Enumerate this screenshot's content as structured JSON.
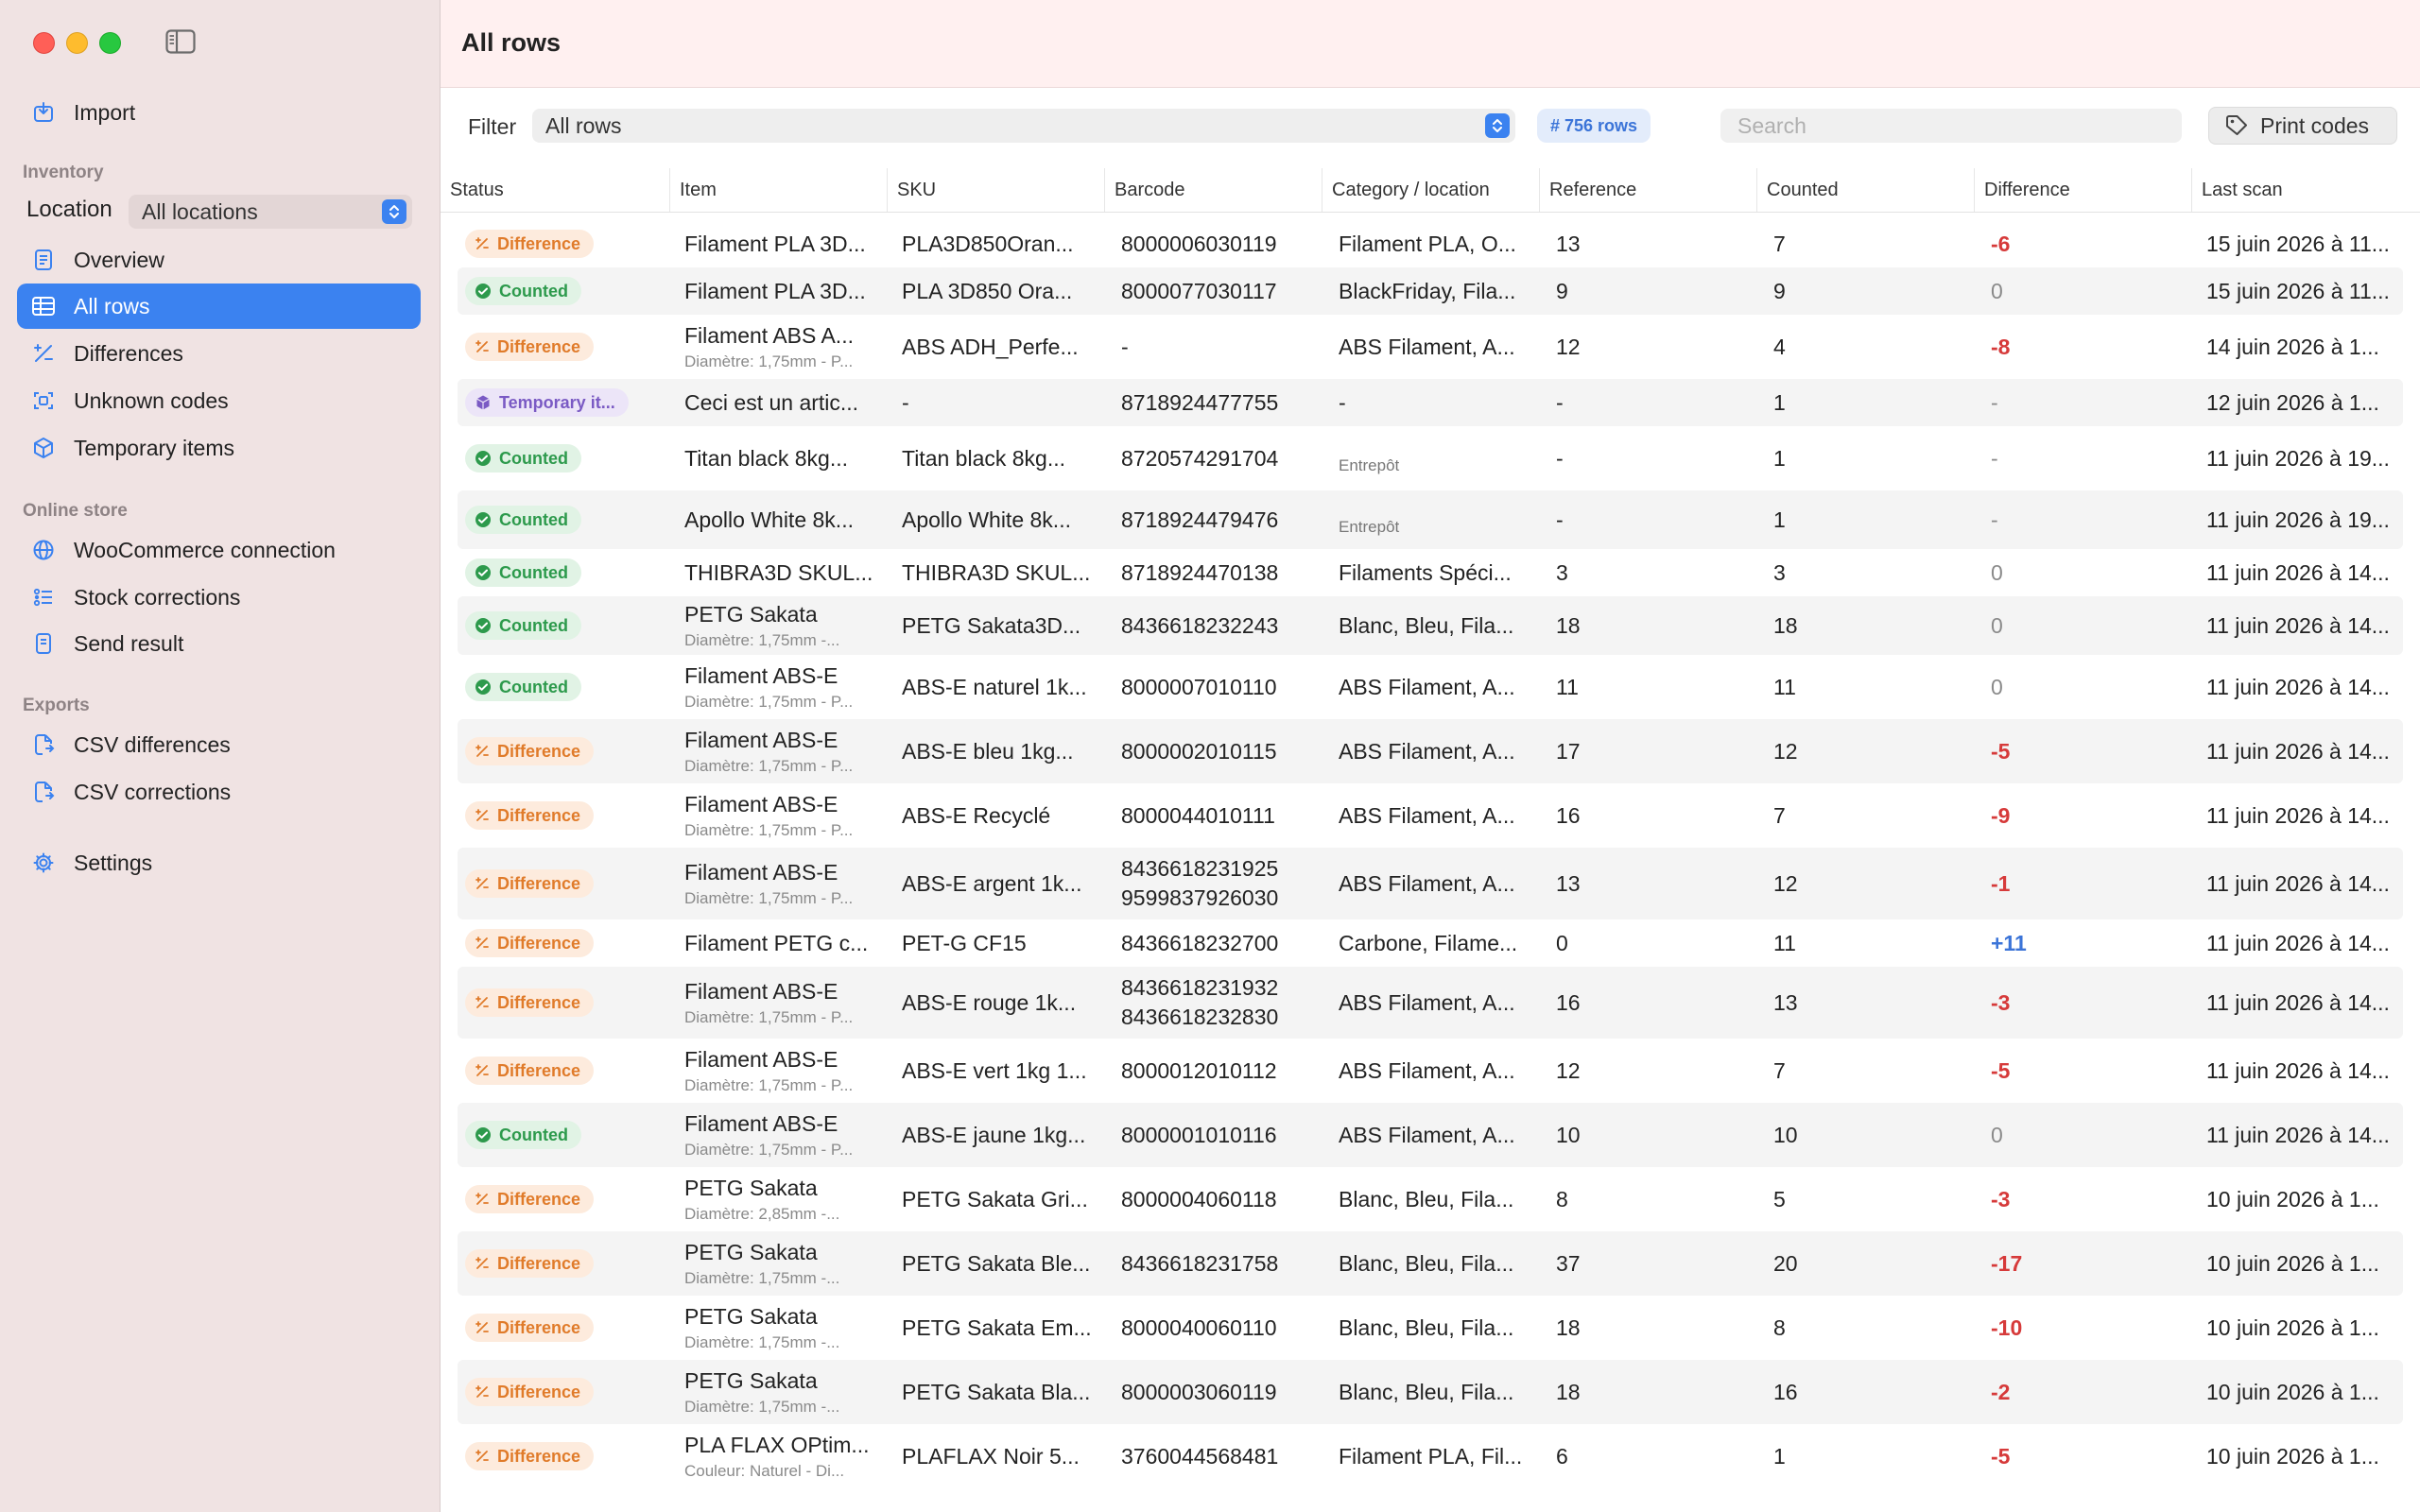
{
  "sidebar": {
    "import": "Import",
    "inventory_header": "Inventory",
    "location_label": "Location",
    "location_value": "All locations",
    "nav_inventory": [
      "Overview",
      "All rows",
      "Differences",
      "Unknown codes",
      "Temporary items"
    ],
    "online_header": "Online store",
    "nav_online": [
      "WooCommerce connection",
      "Stock corrections",
      "Send result"
    ],
    "exports_header": "Exports",
    "nav_exports": [
      "CSV differences",
      "CSV corrections"
    ],
    "settings": "Settings",
    "active_index": 1,
    "accent_color": "#3b82f0"
  },
  "header": {
    "title": "All rows"
  },
  "toolbar": {
    "filter_label": "Filter",
    "filter_value": "All rows",
    "rows_badge": "# 756 rows",
    "search_placeholder": "Search",
    "print_label": "Print codes"
  },
  "table": {
    "columns": [
      "Status",
      "Item",
      "SKU",
      "Barcode",
      "Category / location",
      "Reference",
      "Counted",
      "Difference",
      "Last scan"
    ],
    "rows": [
      {
        "status": "Difference",
        "item": "Filament PLA 3D...",
        "item_sub": "",
        "sku": "PLA3D850Oran...",
        "barcode": "8000006030119",
        "barcode2": "",
        "category": "Filament PLA, O...",
        "category_sub": "",
        "reference": "13",
        "counted": "7",
        "difference": "-6",
        "last_scan": "15 juin 2026 à 11..."
      },
      {
        "status": "Counted",
        "item": "Filament PLA 3D...",
        "item_sub": "",
        "sku": "PLA 3D850 Ora...",
        "barcode": "8000077030117",
        "barcode2": "",
        "category": "BlackFriday, Fila...",
        "category_sub": "",
        "reference": "9",
        "counted": "9",
        "difference": "0",
        "last_scan": "15 juin 2026 à 11..."
      },
      {
        "status": "Difference",
        "item": "Filament ABS A...",
        "item_sub": "Diamètre: 1,75mm - P...",
        "sku": "ABS ADH_Perfe...",
        "barcode": "-",
        "barcode2": "",
        "category": "ABS Filament, A...",
        "category_sub": "",
        "reference": "12",
        "counted": "4",
        "difference": "-8",
        "last_scan": "14 juin 2026 à 1..."
      },
      {
        "status": "Temporary it...",
        "item": "Ceci est un artic...",
        "item_sub": "",
        "sku": "-",
        "barcode": "8718924477755",
        "barcode2": "",
        "category": "-",
        "category_sub": "",
        "reference": "-",
        "counted": "1",
        "difference": "-",
        "last_scan": "12 juin 2026 à 1..."
      },
      {
        "status": "Counted",
        "item": "Titan black 8kg...",
        "item_sub": "",
        "sku": "Titan black 8kg...",
        "barcode": "8720574291704",
        "barcode2": "",
        "category": "",
        "category_sub": "Entrepôt",
        "reference": "-",
        "counted": "1",
        "difference": "-",
        "last_scan": "11 juin 2026 à 19..."
      },
      {
        "status": "Counted",
        "item": "Apollo White 8k...",
        "item_sub": "",
        "sku": "Apollo White 8k...",
        "barcode": "8718924479476",
        "barcode2": "",
        "category": "",
        "category_sub": "Entrepôt",
        "reference": "-",
        "counted": "1",
        "difference": "-",
        "last_scan": "11 juin 2026 à 19..."
      },
      {
        "status": "Counted",
        "item": "THIBRA3D SKUL...",
        "item_sub": "",
        "sku": "THIBRA3D SKUL...",
        "barcode": "8718924470138",
        "barcode2": "",
        "category": "Filaments Spéci...",
        "category_sub": "",
        "reference": "3",
        "counted": "3",
        "difference": "0",
        "last_scan": "11 juin 2026 à 14..."
      },
      {
        "status": "Counted",
        "item": "PETG Sakata",
        "item_sub": "Diamètre: 1,75mm -...",
        "sku": "PETG Sakata3D...",
        "barcode": "8436618232243",
        "barcode2": "",
        "category": "Blanc, Bleu, Fila...",
        "category_sub": "",
        "reference": "18",
        "counted": "18",
        "difference": "0",
        "last_scan": "11 juin 2026 à 14..."
      },
      {
        "status": "Counted",
        "item": "Filament ABS-E",
        "item_sub": "Diamètre: 1,75mm - P...",
        "sku": "ABS-E naturel 1k...",
        "barcode": "8000007010110",
        "barcode2": "",
        "category": "ABS Filament, A...",
        "category_sub": "",
        "reference": "11",
        "counted": "11",
        "difference": "0",
        "last_scan": "11 juin 2026 à 14..."
      },
      {
        "status": "Difference",
        "item": "Filament ABS-E",
        "item_sub": "Diamètre: 1,75mm - P...",
        "sku": "ABS-E bleu 1kg...",
        "barcode": "8000002010115",
        "barcode2": "",
        "category": "ABS Filament, A...",
        "category_sub": "",
        "reference": "17",
        "counted": "12",
        "difference": "-5",
        "last_scan": "11 juin 2026 à 14..."
      },
      {
        "status": "Difference",
        "item": "Filament ABS-E",
        "item_sub": "Diamètre: 1,75mm - P...",
        "sku": "ABS-E Recyclé",
        "barcode": "8000044010111",
        "barcode2": "",
        "category": "ABS Filament, A...",
        "category_sub": "",
        "reference": "16",
        "counted": "7",
        "difference": "-9",
        "last_scan": "11 juin 2026 à 14..."
      },
      {
        "status": "Difference",
        "item": "Filament ABS-E",
        "item_sub": "Diamètre: 1,75mm - P...",
        "sku": "ABS-E argent 1k...",
        "barcode": "8436618231925",
        "barcode2": "9599837926030",
        "category": "ABS Filament, A...",
        "category_sub": "",
        "reference": "13",
        "counted": "12",
        "difference": "-1",
        "last_scan": "11 juin 2026 à 14..."
      },
      {
        "status": "Difference",
        "item": "Filament PETG c...",
        "item_sub": "",
        "sku": "PET-G CF15",
        "barcode": "8436618232700",
        "barcode2": "",
        "category": "Carbone, Filame...",
        "category_sub": "",
        "reference": "0",
        "counted": "11",
        "difference": "+11",
        "last_scan": "11 juin 2026 à 14..."
      },
      {
        "status": "Difference",
        "item": "Filament ABS-E",
        "item_sub": "Diamètre: 1,75mm - P...",
        "sku": "ABS-E rouge 1k...",
        "barcode": "8436618231932",
        "barcode2": "8436618232830",
        "category": "ABS Filament, A...",
        "category_sub": "",
        "reference": "16",
        "counted": "13",
        "difference": "-3",
        "last_scan": "11 juin 2026 à 14..."
      },
      {
        "status": "Difference",
        "item": "Filament ABS-E",
        "item_sub": "Diamètre: 1,75mm - P...",
        "sku": "ABS-E vert 1kg 1...",
        "barcode": "8000012010112",
        "barcode2": "",
        "category": "ABS Filament, A...",
        "category_sub": "",
        "reference": "12",
        "counted": "7",
        "difference": "-5",
        "last_scan": "11 juin 2026 à 14..."
      },
      {
        "status": "Counted",
        "item": "Filament ABS-E",
        "item_sub": "Diamètre: 1,75mm - P...",
        "sku": "ABS-E jaune 1kg...",
        "barcode": "8000001010116",
        "barcode2": "",
        "category": "ABS Filament, A...",
        "category_sub": "",
        "reference": "10",
        "counted": "10",
        "difference": "0",
        "last_scan": "11 juin 2026 à 14..."
      },
      {
        "status": "Difference",
        "item": "PETG Sakata",
        "item_sub": "Diamètre: 2,85mm -...",
        "sku": "PETG Sakata Gri...",
        "barcode": "8000004060118",
        "barcode2": "",
        "category": "Blanc, Bleu, Fila...",
        "category_sub": "",
        "reference": "8",
        "counted": "5",
        "difference": "-3",
        "last_scan": "10 juin 2026 à 1..."
      },
      {
        "status": "Difference",
        "item": "PETG Sakata",
        "item_sub": "Diamètre: 1,75mm -...",
        "sku": "PETG Sakata Ble...",
        "barcode": "8436618231758",
        "barcode2": "",
        "category": "Blanc, Bleu, Fila...",
        "category_sub": "",
        "reference": "37",
        "counted": "20",
        "difference": "-17",
        "last_scan": "10 juin 2026 à 1..."
      },
      {
        "status": "Difference",
        "item": "PETG Sakata",
        "item_sub": "Diamètre: 1,75mm -...",
        "sku": "PETG Sakata Em...",
        "barcode": "8000040060110",
        "barcode2": "",
        "category": "Blanc, Bleu, Fila...",
        "category_sub": "",
        "reference": "18",
        "counted": "8",
        "difference": "-10",
        "last_scan": "10 juin 2026 à 1..."
      },
      {
        "status": "Difference",
        "item": "PETG Sakata",
        "item_sub": "Diamètre: 1,75mm -...",
        "sku": "PETG Sakata Bla...",
        "barcode": "8000003060119",
        "barcode2": "",
        "category": "Blanc, Bleu, Fila...",
        "category_sub": "",
        "reference": "18",
        "counted": "16",
        "difference": "-2",
        "last_scan": "10 juin 2026 à 1..."
      },
      {
        "status": "Difference",
        "item": "PLA FLAX OPtim...",
        "item_sub": "Couleur: Naturel - Di...",
        "sku": "PLAFLAX Noir 5...",
        "barcode": "3760044568481",
        "barcode2": "",
        "category": "Filament PLA, Fil...",
        "category_sub": "",
        "reference": "6",
        "counted": "1",
        "difference": "-5",
        "last_scan": "10 juin 2026 à 1..."
      }
    ]
  },
  "colors": {
    "sidebar_bg": "#f0e3e3",
    "accent": "#3b82f0",
    "negative": "#d63a3a",
    "positive": "#3b74d8",
    "difference_badge": "#e07b2a",
    "counted_badge": "#2d9a4c",
    "temporary_badge": "#7a5ac4"
  }
}
